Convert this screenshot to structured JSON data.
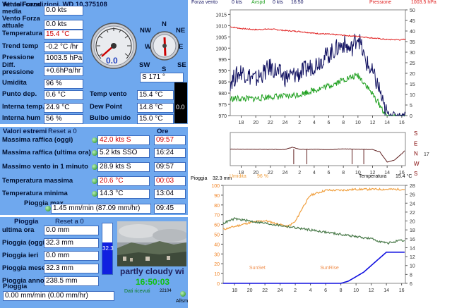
{
  "current": {
    "title": "Attuali condizioni, WD 10.375108",
    "rows": [
      {
        "label": "Vento Forza media",
        "value": "0.0 kts"
      },
      {
        "label": "Vento Forza attuale",
        "value": "0.0 kts"
      },
      {
        "label": "Temperatura",
        "value": "15.4 °C"
      },
      {
        "label": "Trend temp",
        "value": "-0.2 °C /hr"
      },
      {
        "label": "Pressione",
        "value": "1003.5 hPa"
      },
      {
        "label": "Diff. pressione",
        "value": "+0.6hPa/hr"
      },
      {
        "label": "Umidita",
        "value": "96 %"
      },
      {
        "label": "Punto dep.",
        "value": "0.6 °C"
      },
      {
        "label": "Interna temp.",
        "value": "24.9 °C"
      },
      {
        "label": "Interna hum",
        "value": "56 %"
      }
    ],
    "right_rows": [
      {
        "label": "Temp vento",
        "value": "15.4 °C"
      },
      {
        "label": "Dew Point",
        "value": "14.8 °C"
      },
      {
        "label": "Bulbo umido",
        "value": "15.0 °C"
      }
    ],
    "gauge_value": "0.0",
    "compass": {
      "nw": "NW",
      "n": "N",
      "ne": "NE",
      "w": "W",
      "e": "E",
      "sw": "SW",
      "s": "S",
      "se": "SE"
    },
    "direction": "S  171 °",
    "uv_value": "0.0"
  },
  "extremes": {
    "title": "Valori estremi",
    "reset": "Reset a 0",
    "ore": "Ore",
    "rows": [
      {
        "label": "Massima raffica (oggi)",
        "value": "42.0 kts    S",
        "time": "09:57",
        "red": true
      },
      {
        "label": "Massima raffica (ultima ora)",
        "value": "5.2 kts SSO",
        "time": "16:24",
        "red": false
      },
      {
        "label": "Massimo vento in 1 minuto",
        "value": "28.9 kts    S",
        "time": "09:57",
        "red": false
      },
      {
        "label": "Temperatura massima",
        "value": "20.6 °C",
        "time": "00:03",
        "red": true
      },
      {
        "label": "Temperatura minima",
        "value": "14.3 °C",
        "time": "13:04",
        "red": false
      }
    ],
    "rain_max_label": "Pioggia max",
    "rain_max_value": "1.45 mm/min (87.09 mm/hr)",
    "rain_max_time": "09:45"
  },
  "rain": {
    "title": "Pioggia",
    "reset": "Reset a 0",
    "rows": [
      {
        "label": "ultima ora",
        "value": "0.0 mm"
      },
      {
        "label": "Pioggia (oggi)",
        "value": "32.3 mm"
      },
      {
        "label": "Pioggia ieri",
        "value": "0.0 mm"
      },
      {
        "label": "Pioggia mese",
        "value": "32.3 mm"
      },
      {
        "label": "Pioggia anno",
        "value": "238.5 mm"
      }
    ],
    "rate_label": "Pioggia",
    "rate_value": "0.00 mm/min (0.00 mm/hr)",
    "bar_value": "32.3",
    "bar_fill": 0.62
  },
  "webcam": {
    "sky": "partly cloudy wi",
    "time": "16:50:03",
    "received": "Dati ricevuti",
    "code": "22104",
    "allarm": "Allsm"
  },
  "top_chart": {
    "legend": {
      "forza": "Forza vento",
      "kts": "0 kts",
      "avgspd": "Avspd",
      "kts2": "0 kts",
      "time": "16:50",
      "pressione": "Pressione",
      "pval": "1003.5 hPa"
    },
    "colors": {
      "pressure": "#e02020",
      "gust": "#101060",
      "avg": "#20a020"
    }
  },
  "chart_data": [
    {
      "type": "line",
      "title": "",
      "x_ticks": [
        "18",
        "20",
        "22",
        "24",
        "2",
        "4",
        "6",
        "8",
        "10",
        "12",
        "14",
        "16"
      ],
      "y_left_ticks": [
        970,
        975,
        980,
        985,
        990,
        995,
        1000,
        1005,
        1010,
        1015
      ],
      "y_right_ticks": [
        0,
        5,
        10,
        15,
        20,
        25,
        30,
        35,
        40,
        45,
        50
      ],
      "ylim_left": [
        970,
        1017
      ],
      "ylim_right": [
        0,
        50
      ],
      "series": [
        {
          "name": "Pressione",
          "axis": "left",
          "x": [
            16.5,
            18,
            20,
            22,
            24,
            26,
            28,
            30,
            32,
            34,
            36,
            38,
            40,
            40.5
          ],
          "values": [
            1009.5,
            1008.7,
            1008.2,
            1008.5,
            1007.8,
            1007.4,
            1006.6,
            1006.2,
            1005.7,
            1005.2,
            1004.5,
            1003.8,
            1003.7,
            1004.0
          ]
        },
        {
          "name": "Forza vento",
          "axis": "right",
          "x": [
            16.5,
            18,
            20,
            22,
            24,
            26,
            28,
            30,
            32,
            33,
            34,
            35,
            36,
            37,
            37.5,
            38,
            40,
            40.5
          ],
          "values": [
            16,
            21,
            17,
            23,
            18,
            20,
            24,
            29,
            34,
            31,
            38,
            26,
            20,
            12,
            4,
            1,
            0,
            1
          ]
        },
        {
          "name": "Avspd",
          "axis": "right",
          "x": [
            16.5,
            18,
            20,
            22,
            24,
            26,
            28,
            30,
            32,
            33,
            34,
            35,
            36,
            37,
            37.5,
            38,
            40,
            40.5
          ],
          "values": [
            8,
            8,
            8,
            9,
            9,
            10,
            12,
            14,
            17,
            18,
            19,
            15,
            10,
            5,
            2,
            0,
            0,
            0
          ]
        }
      ]
    },
    {
      "type": "line",
      "title": "",
      "x_ticks": [
        "18",
        "20",
        "22",
        "24",
        "2",
        "4",
        "6",
        "8",
        "10",
        "12",
        "14",
        "16"
      ],
      "y_right_labels": [
        "S",
        "E",
        "N",
        "W",
        "S"
      ],
      "annotation": "170",
      "series": [
        {
          "name": "Direction",
          "x": [
            16.5,
            18,
            20,
            22,
            24,
            25,
            26,
            27,
            28,
            30,
            32,
            34,
            36,
            37,
            38,
            39,
            40,
            40.5
          ],
          "values": [
            180,
            178,
            178,
            176,
            175,
            200,
            178,
            176,
            178,
            175,
            182,
            178,
            175,
            150,
            40,
            60,
            130,
            170
          ]
        }
      ]
    },
    {
      "type": "line",
      "title": "",
      "header": {
        "pioggia": "Pioggia",
        "pval": "32.3 mm",
        "umidita": "Umidita",
        "uval": "96 %",
        "temp": "Temperatura",
        "tval": "15.4 °C"
      },
      "x_ticks": [
        "18",
        "20",
        "22",
        "24",
        "2",
        "4",
        "6",
        "8",
        "10",
        "12",
        "14",
        "16"
      ],
      "y_left_ticks": [
        0,
        10,
        20,
        30,
        40,
        50,
        60,
        70,
        80,
        90,
        100
      ],
      "y_right_ticks": [
        6,
        8,
        10,
        12,
        14,
        16,
        18,
        20,
        22,
        24,
        26,
        28
      ],
      "ylim_left": [
        0,
        100
      ],
      "ylim_right": [
        6,
        28
      ],
      "annotations": [
        "SunSet",
        "SunRise"
      ],
      "series": [
        {
          "name": "Umidita",
          "axis": "left",
          "x": [
            16.5,
            18,
            20,
            22,
            24,
            25,
            26,
            27,
            28,
            30,
            32,
            34,
            36,
            38,
            40,
            40.5
          ],
          "values": [
            55,
            58,
            62,
            64,
            60,
            58,
            63,
            78,
            90,
            95,
            95,
            96,
            96,
            96,
            96,
            96
          ]
        },
        {
          "name": "Temperatura",
          "axis": "right",
          "x": [
            16.5,
            18,
            20,
            22,
            24,
            26,
            28,
            30,
            32,
            34,
            36,
            38,
            40,
            40.5
          ],
          "values": [
            19.5,
            20.5,
            20,
            19.5,
            19,
            18.5,
            18,
            17.5,
            17,
            16.5,
            16,
            15,
            15.6,
            15.4
          ]
        },
        {
          "name": "Pioggia",
          "axis": "right",
          "x": [
            16.5,
            18,
            20,
            22,
            24,
            26,
            28,
            30,
            32,
            33,
            34,
            35,
            36,
            37,
            38,
            40,
            40.5
          ],
          "values": [
            6,
            6,
            6,
            6,
            6,
            6,
            6,
            6,
            6,
            6.5,
            7.5,
            8.5,
            10,
            11.5,
            13,
            13,
            13
          ]
        }
      ]
    }
  ]
}
